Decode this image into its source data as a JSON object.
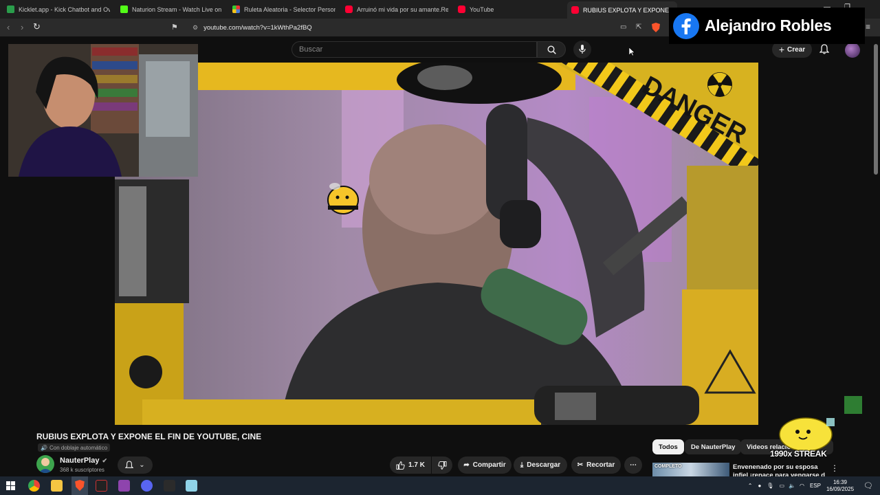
{
  "browser": {
    "tabs": [
      {
        "title": "Kicklet.app - Kick Chatbot and Overl",
        "color": "#2a9d4b"
      },
      {
        "title": "Naturion Stream - Watch Live on Kick",
        "color": "#53fc18"
      },
      {
        "title": "Ruleta Aleatoria - Selector Personaliz",
        "color": "#4a7bd6"
      },
      {
        "title": "Arruinó mi vida por su amante.Rena",
        "color": "#ff0033"
      },
      {
        "title": "YouTube",
        "color": "#ff0033"
      },
      {
        "title": "RUBIUS EXPLOTA Y EXPONE E",
        "color": "#ff0033",
        "active": true
      }
    ],
    "url": "youtube.com/watch?v=1kWthPa2fBQ"
  },
  "youtube": {
    "search_placeholder": "Buscar",
    "create_label": "Crear",
    "video": {
      "title": "RUBIUS EXPLOTA Y EXPONE EL FIN DE YOUTUBE, CINE",
      "dubbed_label": "Con doblaje automático",
      "channel_name": "NauterPlay",
      "subscribers": "368 k suscriptores",
      "likes": "1.7 K",
      "share_label": "Compartir",
      "download_label": "Descargar",
      "clip_label": "Recortar",
      "overlay_text": "DANGER"
    },
    "chips": [
      "Todos",
      "De NauterPlay",
      "Videos relacionados"
    ],
    "related": {
      "title": "Envenenado por su esposa infiel ¡renace para vengarse d",
      "thumb_label": "COMPLETO"
    }
  },
  "overlay": {
    "facebook_name": "Alejandro Robles",
    "streak_text": "1990x STREAK"
  },
  "taskbar": {
    "language": "ESP",
    "time": "16:39",
    "date": "16/09/2025"
  }
}
